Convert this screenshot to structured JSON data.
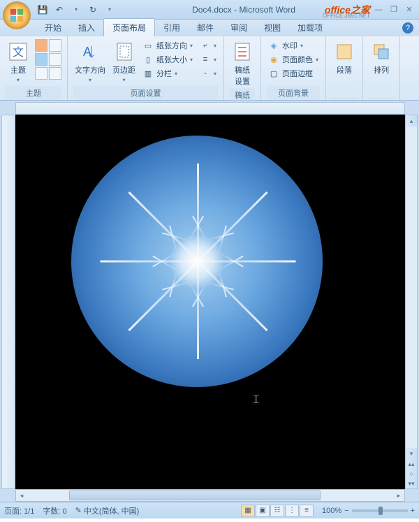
{
  "title": "Doc4.docx - Microsoft Word",
  "watermark": "office之家",
  "watermark_sub": "OFFICE.JB51.NET",
  "qat": {
    "save": "💾",
    "undo": "↶",
    "redo": "↻"
  },
  "win": {
    "min": "—",
    "max": "❐",
    "close": "✕"
  },
  "tabs": [
    "开始",
    "插入",
    "页面布局",
    "引用",
    "邮件",
    "审阅",
    "视图",
    "加载项"
  ],
  "active_tab": 2,
  "ribbon": {
    "g1": {
      "label": "主题",
      "theme": "主题"
    },
    "g2": {
      "label": "页面设置",
      "textdir": "文字方向",
      "margin": "页边距",
      "orient": "纸张方向",
      "size": "纸张大小",
      "columns": "分栏"
    },
    "g3": {
      "label": "稿纸",
      "btn": "稿纸\n设置"
    },
    "g4": {
      "label": "页面背景",
      "watermark": "水印",
      "color": "页面颜色",
      "border": "页面边框"
    },
    "g5": {
      "label": "",
      "para": "段落"
    },
    "g6": {
      "label": "",
      "arrange": "排列"
    }
  },
  "status": {
    "page": "页面: 1/1",
    "words": "字数: 0",
    "lang": "中文(简体, 中国)",
    "zoom": "100%"
  }
}
